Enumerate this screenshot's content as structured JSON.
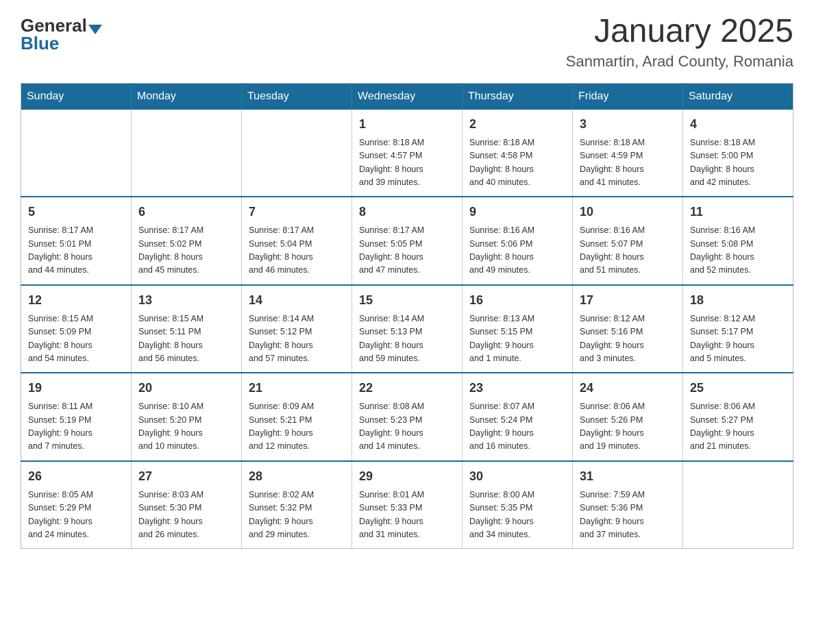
{
  "header": {
    "logo_general": "General",
    "logo_blue": "Blue",
    "title": "January 2025",
    "subtitle": "Sanmartin, Arad County, Romania"
  },
  "weekdays": [
    "Sunday",
    "Monday",
    "Tuesday",
    "Wednesday",
    "Thursday",
    "Friday",
    "Saturday"
  ],
  "weeks": [
    [
      {
        "day": "",
        "info": ""
      },
      {
        "day": "",
        "info": ""
      },
      {
        "day": "",
        "info": ""
      },
      {
        "day": "1",
        "info": "Sunrise: 8:18 AM\nSunset: 4:57 PM\nDaylight: 8 hours\nand 39 minutes."
      },
      {
        "day": "2",
        "info": "Sunrise: 8:18 AM\nSunset: 4:58 PM\nDaylight: 8 hours\nand 40 minutes."
      },
      {
        "day": "3",
        "info": "Sunrise: 8:18 AM\nSunset: 4:59 PM\nDaylight: 8 hours\nand 41 minutes."
      },
      {
        "day": "4",
        "info": "Sunrise: 8:18 AM\nSunset: 5:00 PM\nDaylight: 8 hours\nand 42 minutes."
      }
    ],
    [
      {
        "day": "5",
        "info": "Sunrise: 8:17 AM\nSunset: 5:01 PM\nDaylight: 8 hours\nand 44 minutes."
      },
      {
        "day": "6",
        "info": "Sunrise: 8:17 AM\nSunset: 5:02 PM\nDaylight: 8 hours\nand 45 minutes."
      },
      {
        "day": "7",
        "info": "Sunrise: 8:17 AM\nSunset: 5:04 PM\nDaylight: 8 hours\nand 46 minutes."
      },
      {
        "day": "8",
        "info": "Sunrise: 8:17 AM\nSunset: 5:05 PM\nDaylight: 8 hours\nand 47 minutes."
      },
      {
        "day": "9",
        "info": "Sunrise: 8:16 AM\nSunset: 5:06 PM\nDaylight: 8 hours\nand 49 minutes."
      },
      {
        "day": "10",
        "info": "Sunrise: 8:16 AM\nSunset: 5:07 PM\nDaylight: 8 hours\nand 51 minutes."
      },
      {
        "day": "11",
        "info": "Sunrise: 8:16 AM\nSunset: 5:08 PM\nDaylight: 8 hours\nand 52 minutes."
      }
    ],
    [
      {
        "day": "12",
        "info": "Sunrise: 8:15 AM\nSunset: 5:09 PM\nDaylight: 8 hours\nand 54 minutes."
      },
      {
        "day": "13",
        "info": "Sunrise: 8:15 AM\nSunset: 5:11 PM\nDaylight: 8 hours\nand 56 minutes."
      },
      {
        "day": "14",
        "info": "Sunrise: 8:14 AM\nSunset: 5:12 PM\nDaylight: 8 hours\nand 57 minutes."
      },
      {
        "day": "15",
        "info": "Sunrise: 8:14 AM\nSunset: 5:13 PM\nDaylight: 8 hours\nand 59 minutes."
      },
      {
        "day": "16",
        "info": "Sunrise: 8:13 AM\nSunset: 5:15 PM\nDaylight: 9 hours\nand 1 minute."
      },
      {
        "day": "17",
        "info": "Sunrise: 8:12 AM\nSunset: 5:16 PM\nDaylight: 9 hours\nand 3 minutes."
      },
      {
        "day": "18",
        "info": "Sunrise: 8:12 AM\nSunset: 5:17 PM\nDaylight: 9 hours\nand 5 minutes."
      }
    ],
    [
      {
        "day": "19",
        "info": "Sunrise: 8:11 AM\nSunset: 5:19 PM\nDaylight: 9 hours\nand 7 minutes."
      },
      {
        "day": "20",
        "info": "Sunrise: 8:10 AM\nSunset: 5:20 PM\nDaylight: 9 hours\nand 10 minutes."
      },
      {
        "day": "21",
        "info": "Sunrise: 8:09 AM\nSunset: 5:21 PM\nDaylight: 9 hours\nand 12 minutes."
      },
      {
        "day": "22",
        "info": "Sunrise: 8:08 AM\nSunset: 5:23 PM\nDaylight: 9 hours\nand 14 minutes."
      },
      {
        "day": "23",
        "info": "Sunrise: 8:07 AM\nSunset: 5:24 PM\nDaylight: 9 hours\nand 16 minutes."
      },
      {
        "day": "24",
        "info": "Sunrise: 8:06 AM\nSunset: 5:26 PM\nDaylight: 9 hours\nand 19 minutes."
      },
      {
        "day": "25",
        "info": "Sunrise: 8:06 AM\nSunset: 5:27 PM\nDaylight: 9 hours\nand 21 minutes."
      }
    ],
    [
      {
        "day": "26",
        "info": "Sunrise: 8:05 AM\nSunset: 5:29 PM\nDaylight: 9 hours\nand 24 minutes."
      },
      {
        "day": "27",
        "info": "Sunrise: 8:03 AM\nSunset: 5:30 PM\nDaylight: 9 hours\nand 26 minutes."
      },
      {
        "day": "28",
        "info": "Sunrise: 8:02 AM\nSunset: 5:32 PM\nDaylight: 9 hours\nand 29 minutes."
      },
      {
        "day": "29",
        "info": "Sunrise: 8:01 AM\nSunset: 5:33 PM\nDaylight: 9 hours\nand 31 minutes."
      },
      {
        "day": "30",
        "info": "Sunrise: 8:00 AM\nSunset: 5:35 PM\nDaylight: 9 hours\nand 34 minutes."
      },
      {
        "day": "31",
        "info": "Sunrise: 7:59 AM\nSunset: 5:36 PM\nDaylight: 9 hours\nand 37 minutes."
      },
      {
        "day": "",
        "info": ""
      }
    ]
  ]
}
